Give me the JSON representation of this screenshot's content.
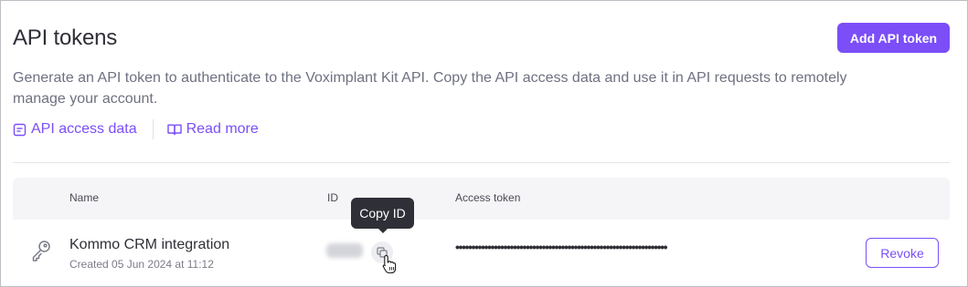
{
  "header": {
    "title": "API tokens",
    "add_button": "Add API token"
  },
  "description": "Generate an API token to authenticate to the Voximplant Kit API. Copy the API access data and use it in API requests to remotely manage your account.",
  "links": {
    "access_data": "API access data",
    "read_more": "Read more"
  },
  "table": {
    "columns": [
      "Name",
      "ID",
      "Access token"
    ],
    "rows": [
      {
        "name": "Kommo CRM integration",
        "created": "Created 05 Jun 2024 at 11:12",
        "token": "••••••••••••••••••••••••••••••••••••••••••••••••••••••••••••••••••",
        "revoke": "Revoke"
      }
    ]
  },
  "tooltip": "Copy ID",
  "colors": {
    "accent": "#7b4ef7",
    "tooltip_bg": "#2f3037",
    "header_bg": "#f5f5f8"
  },
  "icons": {
    "access_data": "document-icon",
    "read_more": "book-icon",
    "row": "key-icon",
    "copy": "copy-icon",
    "cursor": "hand-pointer-icon"
  }
}
